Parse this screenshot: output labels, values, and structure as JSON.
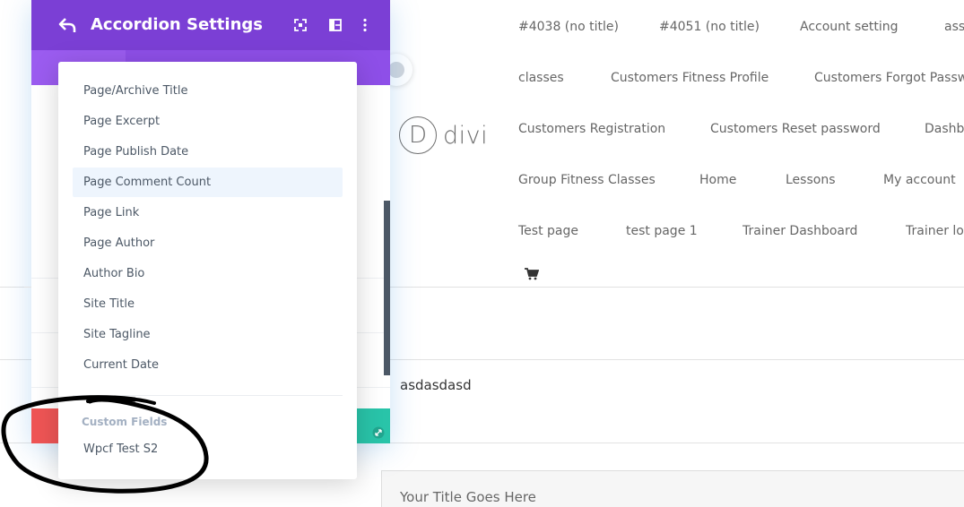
{
  "panel": {
    "title": "Accordion Settings"
  },
  "dropdown": {
    "items": [
      "Page/Archive Title",
      "Page Excerpt",
      "Page Publish Date",
      "Page Comment Count",
      "Page Link",
      "Page Author",
      "Author Bio",
      "Site Title",
      "Site Tagline",
      "Current Date"
    ],
    "highlighted": "Page Comment Count",
    "group_label": "Custom Fields",
    "group_items": [
      "Wpcf Test S2"
    ]
  },
  "site": {
    "logo_letter": "D",
    "logo_text": "divi",
    "nav_rows": [
      [
        "#4038 (no title)",
        "#4051 (no title)",
        "Account setting",
        "ass"
      ],
      [
        "classes",
        "Customers Fitness Profile",
        "Customers Forgot Passw"
      ],
      [
        "Customers Registration",
        "Customers Reset password",
        "Dashb"
      ],
      [
        "Group Fitness Classes",
        "Home",
        "Lessons",
        "My account"
      ],
      [
        "Test page",
        "test page 1",
        "Trainer Dashboard",
        "Trainer lo"
      ]
    ],
    "content_text": "asdasdasd",
    "title_box_text": "Your Title Goes Here"
  },
  "colors": {
    "header_purple": "#7b3fd5",
    "tabs_purple": "#8e4fe8",
    "discard_red": "#ef5555",
    "save_teal": "#29c4a9",
    "highlight_bg": "#eef5fd",
    "text_slate": "#4c5866",
    "group_label": "#a3b0c2"
  },
  "icons": {
    "back": "undo-arrow-icon",
    "fullscreen": "expand-icon",
    "layout": "split-view-icon",
    "more": "more-vertical-icon",
    "cart": "shopping-cart-icon",
    "resize": "resize-icon"
  }
}
